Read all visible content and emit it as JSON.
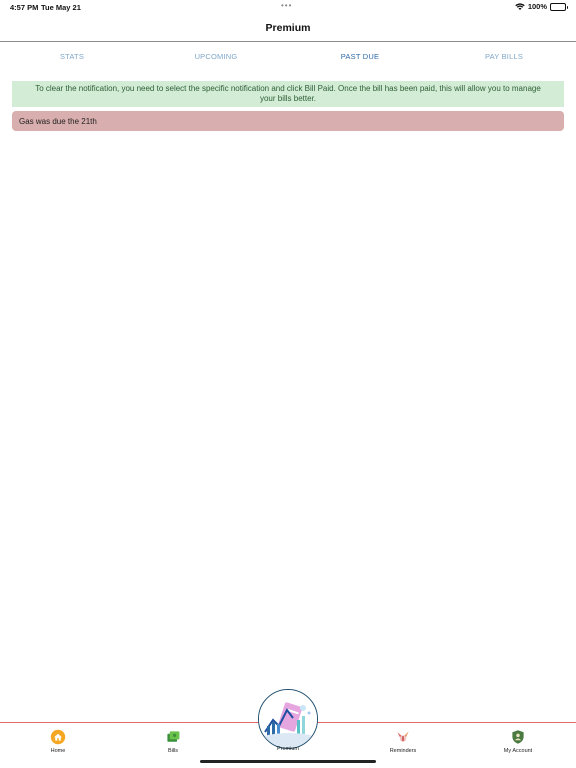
{
  "status_bar": {
    "time": "4:57 PM",
    "date": "Tue May 21",
    "dots": "•••",
    "battery": "100%",
    "battery_level": 1.0
  },
  "header": {
    "title": "Premium"
  },
  "tabs": [
    {
      "label": "STATS",
      "active": false
    },
    {
      "label": "UPCOMING",
      "active": false
    },
    {
      "label": "PAST DUE",
      "active": true
    },
    {
      "label": "PAY BILLS",
      "active": false
    }
  ],
  "notice": {
    "text": "To clear the notification, you need to select the specific notification and click Bill Paid. Once the bill has been paid, this will allow you to manage your bills better."
  },
  "past_due": [
    {
      "text": "Gas was due the 21th"
    }
  ],
  "bottom_nav": {
    "home": "Home",
    "bills": "Bills",
    "premium": "Premium",
    "reminders": "Reminders",
    "account": "My Account"
  },
  "icons": {
    "home": "home-icon",
    "bills": "bills-icon",
    "premium": "premium-badge-icon",
    "reminders": "reminders-icon",
    "account": "account-shield-icon"
  },
  "colors": {
    "notice_bg": "#d3ecd5",
    "past_due_bg": "#d9aeae",
    "active_tab": "#2e6aa6",
    "inactive_tab": "#7fa6c8",
    "nav_border": "#e46b6b"
  }
}
